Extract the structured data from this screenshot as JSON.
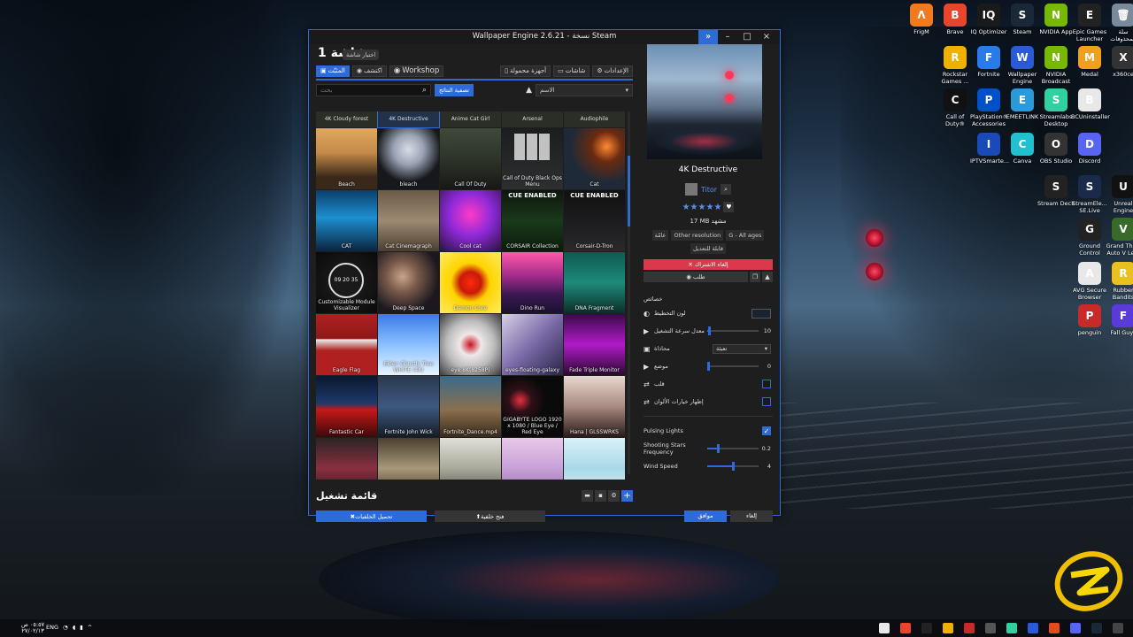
{
  "window": {
    "title": "Wallpaper Engine 2.6.21 - نسخة Steam",
    "screen_title": "شاشة 1",
    "choose_screen": "اختيار شاشة",
    "tabs": {
      "installed": "المثبّت",
      "discover": "اكتشف",
      "workshop": "Workshop"
    },
    "right_tabs": {
      "devices": "أجهزة محمولة",
      "screens": "شاشات",
      "settings": "الإعدادات"
    },
    "search_placeholder": "بحث",
    "filter_button": "تصفية النتائج",
    "sort_value": "الاسم",
    "playlist_label": "قائمة تشغيل",
    "load_wallpaper": "تحميل الخلفيات",
    "open_wallpaper": "فتح خلفية",
    "ok": "موافق",
    "cancel": "إلغاء"
  },
  "header_row": [
    "4K Cloudy forest",
    "4K Destructive",
    "Anime Cat Girl",
    "Arsenal",
    "Audiophile"
  ],
  "tiles": [
    {
      "label": "Beach",
      "bg": "linear-gradient(180deg,#e0a860,#c48a48 40%,#3a2818 80%)"
    },
    {
      "label": "bleach",
      "bg": "radial-gradient(circle at 50% 35%,#d8dde6 0%,#9aa3b4 30%,#16181c 65%)"
    },
    {
      "label": "Call Of Duty",
      "bg": "linear-gradient(180deg,#3f4a3a,#2a2f26 60%,#161814)"
    },
    {
      "label": "Call of Duty Black Ops Menu",
      "bg": "linear-gradient(180deg,#1c1d1e,#2d2f31)"
    },
    {
      "label": "Cat",
      "bg": "radial-gradient(circle at 70% 30%,#ff8a30 0%,#6a2a10 25%,#1e2a38 60%)"
    },
    {
      "label": "CAT",
      "bg": "linear-gradient(180deg,#0b3e6a,#1d8fd0 45%,#0b2440)"
    },
    {
      "label": "Cat Cinemagraph",
      "bg": "linear-gradient(180deg,#6a5a48,#9d8a72 50%,#4a3e30)"
    },
    {
      "label": "Cool cat",
      "bg": "radial-gradient(circle at 50% 40%,#ff3ac6 0%,#8e2ad8 45%,#2a1240)"
    },
    {
      "label": "CORSAIR Collection",
      "bg": "linear-gradient(180deg,#0e150e,#1a3a1a 50%,#0c1a0c)"
    },
    {
      "label": "Corsair-D-Tron",
      "bg": "linear-gradient(180deg,#111,#1e1e22 60%,#2a2a2a)"
    },
    {
      "label": "Customizable Module Visualizer",
      "bg": "radial-gradient(circle,#1a1a1a 30%,#0a0a0a)"
    },
    {
      "label": "Deep Space",
      "bg": "radial-gradient(circle at 40% 40%,#c8a48a 0%,#7a5a4a 30%,#1c1820 70%)"
    },
    {
      "label": "Demon Core",
      "bg": "radial-gradient(circle,#ff2a10 0%,#c81a0a 25%,#ffd400 45%,#ffea60)"
    },
    {
      "label": "Dino Run",
      "bg": "linear-gradient(180deg,#ff5aa8,#a02a8a 40%,#3a1850 70%,#1a1230)"
    },
    {
      "label": "DNA Fragment",
      "bg": "linear-gradient(180deg,#0e5a52,#1e8a7a 50%,#0c2e2a)"
    },
    {
      "label": "Eagle Flag",
      "bg": "linear-gradient(180deg,#b02020,#901818 40%,#e8e8e8 42%,#b02020 60%)"
    },
    {
      "label": "Elden Ghostly Tree WHITE (4K)",
      "bg": "linear-gradient(180deg,#3a7ae8,#8ac0ff 50%,#e8f4ff)"
    },
    {
      "label": "eye 8K(8258P)",
      "bg": "radial-gradient(circle at 50% 50%,#c81020 0%,#f0e8e8 25%,#bcbcbc 55%,#3a3a3a)"
    },
    {
      "label": "eyes-floating-galaxy",
      "bg": "linear-gradient(135deg,#d8d0e8,#7a6aa8 50%,#2a2448)"
    },
    {
      "label": "Fade Triple Monitor",
      "bg": "linear-gradient(180deg,#3a0a4a,#b01ac8 50%,#2a0a30)"
    },
    {
      "label": "Fantastic Car",
      "bg": "linear-gradient(180deg,#0a1830,#1e3a6a 45%,#c81818 55%,#3a0a0a)"
    },
    {
      "label": "Fortnite John Wick",
      "bg": "linear-gradient(180deg,#2a3850,#3e5a80 50%,#141c28)"
    },
    {
      "label": "Fortnite_Dance.mp4",
      "bg": "linear-gradient(180deg,#3a6a8a,#8a7050 55%,#3a2a1a)"
    },
    {
      "label": "GIGABYTE LOGO 1920 x 1080 / Blue Eye / Red Eye",
      "bg": "radial-gradient(circle at 30% 40%,#e83040 0%,#301018 20%,#0a0a0a 45%)"
    },
    {
      "label": "Hana | GLSSWRKS",
      "bg": "linear-gradient(180deg,#e8d8d0,#a88a80 50%,#2a1a1a)"
    },
    {
      "label": "",
      "bg": "linear-gradient(180deg,#2a2424,#8a3040 50%,#1a1414)"
    },
    {
      "label": "",
      "bg": "linear-gradient(180deg,#4a4030,#a8987a 50%,#3a3020)"
    },
    {
      "label": "",
      "bg": "linear-gradient(180deg,#e0e0d8,#a8a89a 50%,#4a4a40)"
    },
    {
      "label": "",
      "bg": "linear-gradient(180deg,#e8c8e8,#c8a0d8 50%,#8a6aa0)"
    },
    {
      "label": "",
      "bg": "linear-gradient(180deg,#d8f0f8,#a8d8e8 50%,#f0f0f0)"
    }
  ],
  "cue_label": "CUE ENABLED",
  "visualizer_number": "09 20 35",
  "detail": {
    "title": "4K Destructive",
    "author": "Titor",
    "stars": "★★★★★",
    "size": "17 MB",
    "size_suffix": "مشهد",
    "tags": [
      "عامّة",
      "Other resolution",
      "G - All ages",
      "قابلة للتعديل"
    ],
    "unsubscribe": "إلغاء الاشتراك",
    "share": "طلب",
    "properties_heading": "خصائص",
    "props": [
      {
        "label": "لون التخطيط",
        "type": "color"
      },
      {
        "label": "معدل سرعة التشغيل",
        "type": "slider",
        "value": "10",
        "level": 0.02
      },
      {
        "label": "محاذاة",
        "type": "dropdown",
        "value": "تعبئة"
      },
      {
        "label": "موضع",
        "type": "slider",
        "value": "0",
        "level": 0.0
      },
      {
        "label": "قلب",
        "type": "check",
        "checked": false
      },
      {
        "label": "إظهار خيارات الألوان",
        "type": "check",
        "checked": false
      }
    ],
    "custom": [
      {
        "label": "Pulsing Lights",
        "type": "check",
        "checked": true
      },
      {
        "label": "Shooting Stars Frequency",
        "type": "slider",
        "value": "0.2",
        "level": 0.2
      },
      {
        "label": "Wind Speed",
        "type": "slider",
        "value": "4",
        "level": 0.5
      }
    ]
  },
  "desktop_icons": [
    {
      "label": "FrigM",
      "color": "#f07a20",
      "glyph": "Λ"
    },
    {
      "label": "Brave",
      "color": "#e8452a",
      "glyph": "B"
    },
    {
      "label": "IQ Optimizer",
      "color": "#1a1a1a",
      "glyph": "IQ"
    },
    {
      "label": "Steam",
      "color": "#1b2838",
      "glyph": "S"
    },
    {
      "label": "NVIDIA App",
      "color": "#76b900",
      "glyph": "N"
    },
    {
      "label": "Epic Games Launcher",
      "color": "#222",
      "glyph": "E"
    },
    {
      "label": "سلة المحذوفات",
      "color": "#7a8a9a",
      "glyph": "🗑"
    },
    {
      "label": "Rockstar Games ...",
      "color": "#f0b000",
      "glyph": "R"
    },
    {
      "label": "Fortnite",
      "color": "#2a7ae8",
      "glyph": "F"
    },
    {
      "label": "Wallpaper Engine",
      "color": "#2a5ad8",
      "glyph": "W"
    },
    {
      "label": "NVIDIA Broadcast",
      "color": "#76b900",
      "glyph": "N"
    },
    {
      "label": "Medal",
      "color": "#f0a020",
      "glyph": "M"
    },
    {
      "label": "x360ce",
      "color": "#333",
      "glyph": "X"
    },
    {
      "label": "Call of Duty®",
      "color": "#111",
      "glyph": "C"
    },
    {
      "label": "PlayStation® Accessories",
      "color": "#0050c8",
      "glyph": "P"
    },
    {
      "label": "EMEETLINK",
      "color": "#2a9ad8",
      "glyph": "E"
    },
    {
      "label": "Streamlabs Desktop",
      "color": "#30d0a0",
      "glyph": "S"
    },
    {
      "label": "BCUninstaller",
      "color": "#e8e8e8",
      "glyph": "B"
    },
    {
      "label": "IPTVSmarte...",
      "color": "#1a4ab8",
      "glyph": "I"
    },
    {
      "label": "Canva",
      "color": "#20c0d0",
      "glyph": "C"
    },
    {
      "label": "OBS Studio",
      "color": "#333",
      "glyph": "O"
    },
    {
      "label": "Discord",
      "color": "#5865f2",
      "glyph": "D"
    },
    {
      "label": "Stream Deck",
      "color": "#222",
      "glyph": "S"
    },
    {
      "label": "StreamEle... SE.Live",
      "color": "#1a2a4a",
      "glyph": "S"
    },
    {
      "label": "Unreal Engine",
      "color": "#111",
      "glyph": "U"
    },
    {
      "label": "Ground Control",
      "color": "#222",
      "glyph": "G"
    },
    {
      "label": "Grand Theft Auto V Le...",
      "color": "#3a6a2a",
      "glyph": "V"
    },
    {
      "label": "AVG Secure Browser",
      "color": "#e8e8e8",
      "glyph": "A"
    },
    {
      "label": "Rubber Bandits",
      "color": "#e8c020",
      "glyph": "R"
    },
    {
      "label": "penguin",
      "color": "#c82a2a",
      "glyph": "P"
    },
    {
      "label": "Fall Guys",
      "color": "#5a3ad8",
      "glyph": "F"
    }
  ],
  "taskbar": {
    "time": "٠٥:٥٧ ص",
    "date": "٢٧/٠٢/١٣",
    "lang": "ENG"
  }
}
